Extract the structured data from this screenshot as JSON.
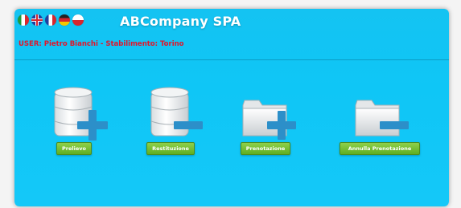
{
  "header": {
    "title": "ABCompany SPA",
    "user_line": "USER: Pietro Bianchi - Stabilimento: Torino",
    "languages": [
      "it-flag-icon",
      "uk-flag-icon",
      "fr-flag-icon",
      "de-flag-icon",
      "pl-flag-icon"
    ]
  },
  "actions": {
    "prelievo": "Prelievo",
    "restituzione": "Restituzione",
    "prenotazione": "Prenotazione",
    "annulla_prenotazione": "Annulla Prenotazione"
  },
  "colors": {
    "panel": "#14c3f2",
    "button": "#6bb72a",
    "user_text": "#e1162b",
    "plus_icon": "#2c8fc9"
  }
}
